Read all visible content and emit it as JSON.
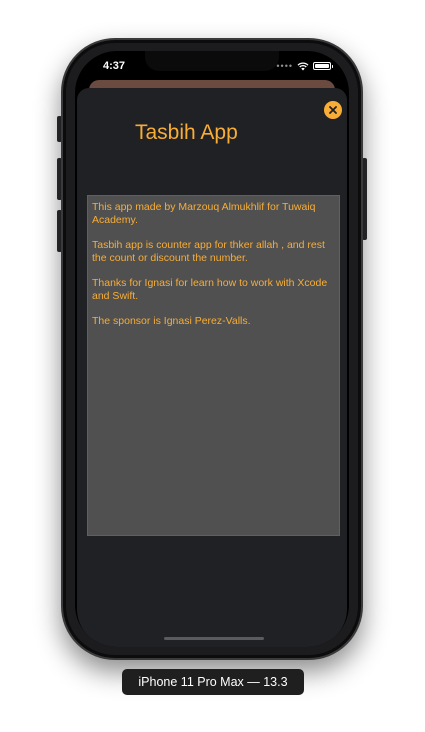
{
  "status_bar": {
    "time": "4:37",
    "cell_signal_icon": "cell-signal-icon",
    "wifi_icon": "wifi-icon",
    "battery_icon": "battery-icon",
    "battery_level": 1.0
  },
  "sheet": {
    "title": "Tasbih App",
    "close_icon": "close-icon",
    "accent_color": "#f8ad37",
    "background_color": "#202124",
    "info_box_color": "#505050",
    "paragraphs": [
      "This app made by Marzouq Almukhlif for Tuwaiq Academy.",
      "Tasbih app is counter app for thker allah , and rest the count or discount the number.",
      "Thanks for Ignasi for learn how to work with Xcode and Swift.",
      "The sponsor is Ignasi Perez-Valls."
    ]
  },
  "device": {
    "label": "iPhone 11 Pro Max — 13.3"
  }
}
